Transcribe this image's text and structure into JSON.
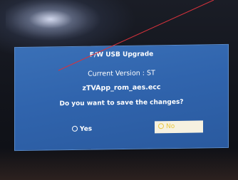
{
  "dialog": {
    "title": "F/W USB Upgrade",
    "current_version": "Current Version : ST",
    "filename": "zTVApp_rom_aes.ecc",
    "question": "Do you want to save the changes?",
    "options": {
      "yes_label": "Yes",
      "no_label": "No",
      "selected": "No"
    }
  },
  "colors": {
    "dialog_background": "#3068b0",
    "text": "#ffffff",
    "selected_option_background": "#f6f1e0",
    "selected_option_text": "#e8c840",
    "annotation_line": "#d8323c"
  }
}
